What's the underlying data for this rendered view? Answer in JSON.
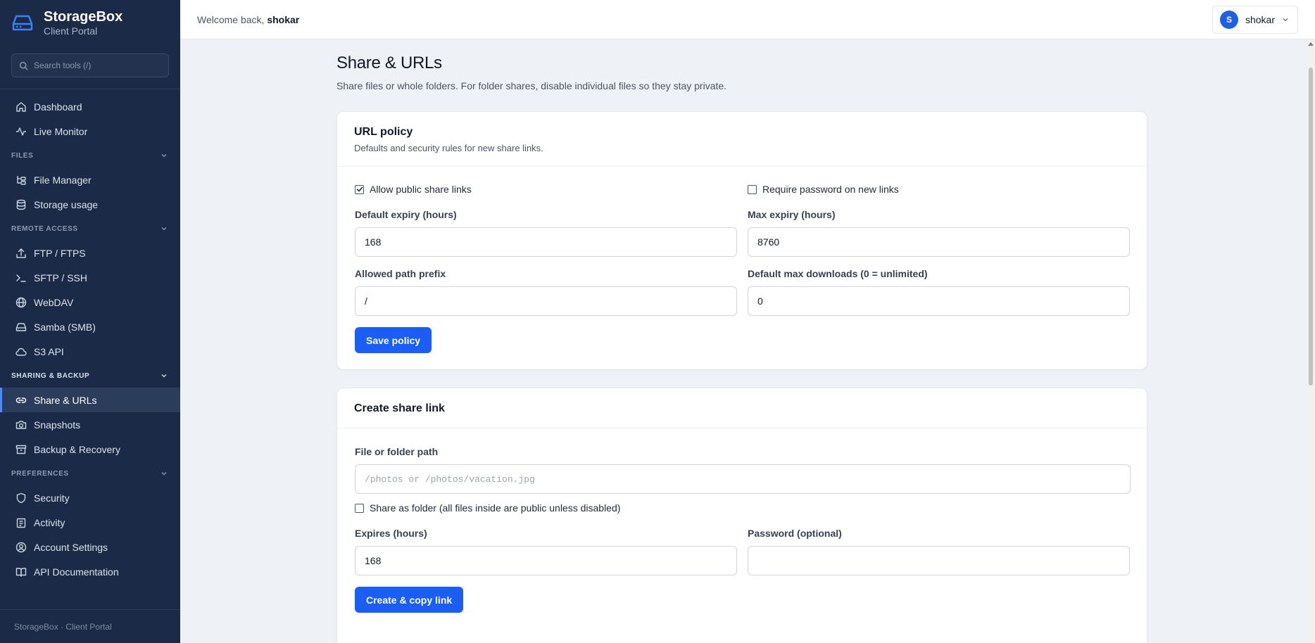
{
  "brand": {
    "title": "StorageBox",
    "subtitle": "Client Portal"
  },
  "search": {
    "placeholder": "Search tools (/)"
  },
  "nav": {
    "dashboard": "Dashboard",
    "live_monitor": "Live Monitor",
    "files_section": "FILES",
    "file_manager": "File Manager",
    "storage_usage": "Storage usage",
    "remote_section": "REMOTE ACCESS",
    "ftp": "FTP / FTPS",
    "sftp": "SFTP / SSH",
    "webdav": "WebDAV",
    "samba": "Samba (SMB)",
    "s3": "S3 API",
    "sharing_section": "SHARING & BACKUP",
    "share_urls": "Share & URLs",
    "snapshots": "Snapshots",
    "backup": "Backup & Recovery",
    "preferences_section": "PREFERENCES",
    "security": "Security",
    "activity": "Activity",
    "account_settings": "Account Settings",
    "api_docs": "API Documentation"
  },
  "footer": "StorageBox · Client Portal",
  "header": {
    "welcome": "Welcome back,",
    "username": "shokar",
    "avatar_initial": "S"
  },
  "page": {
    "title": "Share & URLs",
    "subtitle": "Share files or whole folders. For folder shares, disable individual files so they stay private."
  },
  "policy": {
    "title": "URL policy",
    "description": "Defaults and security rules for new share links.",
    "allow_public_label": "Allow public share links",
    "allow_public_checked": true,
    "require_password_label": "Require password on new links",
    "require_password_checked": false,
    "default_expiry_label": "Default expiry (hours)",
    "default_expiry_value": "168",
    "max_expiry_label": "Max expiry (hours)",
    "max_expiry_value": "8760",
    "path_prefix_label": "Allowed path prefix",
    "path_prefix_value": "/",
    "max_downloads_label": "Default max downloads (0 = unlimited)",
    "max_downloads_value": "0",
    "save_button": "Save policy"
  },
  "create": {
    "title": "Create share link",
    "path_label": "File or folder path",
    "path_placeholder": "/photos or /photos/vacation.jpg",
    "folder_label": "Share as folder (all files inside are public unless disabled)",
    "folder_checked": false,
    "expires_label": "Expires (hours)",
    "expires_value": "168",
    "password_label": "Password (optional)",
    "password_value": "",
    "create_button": "Create & copy link"
  },
  "colors": {
    "sidebar_bg": "#1b2a47",
    "accent": "#1a5ef5",
    "page_bg": "#eef1f5"
  }
}
